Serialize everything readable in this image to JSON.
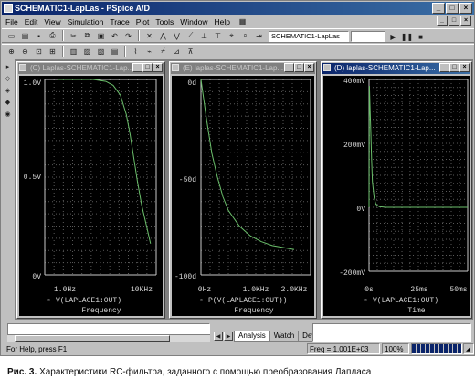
{
  "window": {
    "title": "SCHEMATIC1-LapLas - PSpice A/D",
    "min": "_",
    "max": "□",
    "close": "×"
  },
  "menu": [
    "File",
    "Edit",
    "View",
    "Simulation",
    "Trace",
    "Plot",
    "Tools",
    "Window",
    "Help"
  ],
  "toolbar": {
    "simulation_profile": "SCHEMATIC1-LapLas"
  },
  "plots": [
    {
      "title": "(C) Laplas-SCHEMATIC1-Lap...",
      "active": false,
      "y_ticks": [
        "1.0V",
        "0.5V",
        "0V"
      ],
      "x_ticks": [
        "1.0Hz",
        "10KHz"
      ],
      "trace_label": "V(LAPLACE1:OUT)",
      "x_axis_label": "Frequency"
    },
    {
      "title": "(E) laplas-SCHEMATIC1-Lap...",
      "active": false,
      "y_ticks": [
        "0d",
        "-50d",
        "-100d"
      ],
      "x_ticks": [
        "0Hz",
        "1.0KHz",
        "2.0KHz"
      ],
      "trace_label": "P(V(LAPLACE1:OUT))",
      "x_axis_label": "Frequency"
    },
    {
      "title": "(D) laplas-SCHEMATIC1-Lap...",
      "active": true,
      "y_ticks": [
        "400mV",
        "200mV",
        "0V",
        "-200mV"
      ],
      "x_ticks": [
        "0s",
        "25ms",
        "50ms"
      ],
      "trace_label": "V(LAPLACE1:OUT)",
      "x_axis_label": "Time"
    }
  ],
  "chart_data": [
    {
      "type": "line",
      "xlabel": "Frequency",
      "ylabel": "",
      "y_ticks": [
        "1.0V",
        "0.5V",
        "0V"
      ],
      "x_ticks": [
        "1.0Hz",
        "10KHz"
      ],
      "x_scale": "log",
      "x": [
        1,
        3,
        10,
        30,
        100,
        200,
        400,
        700,
        1000,
        1500,
        2000,
        3000,
        5000,
        7000
      ],
      "series": [
        {
          "name": "V(LAPLACE1:OUT)",
          "values": [
            1.0,
            1.0,
            1.0,
            1.0,
            0.99,
            0.97,
            0.92,
            0.82,
            0.72,
            0.58,
            0.48,
            0.36,
            0.24,
            0.16
          ]
        }
      ],
      "ylim": [
        0,
        1.0
      ],
      "grid": true,
      "color": "#6bbf6b"
    },
    {
      "type": "line",
      "xlabel": "Frequency",
      "ylabel": "",
      "y_ticks": [
        "0d",
        "-50d",
        "-100d"
      ],
      "x_ticks": [
        "0Hz",
        "1.0KHz",
        "2.0KHz"
      ],
      "x": [
        0,
        50,
        100,
        200,
        300,
        400,
        500,
        700,
        900,
        1100,
        1300,
        1500,
        1700
      ],
      "series": [
        {
          "name": "P(V(LAPLACE1:OUT))",
          "values": [
            0,
            -10,
            -20,
            -38,
            -50,
            -60,
            -67,
            -75,
            -80,
            -83,
            -85,
            -86,
            -87
          ]
        }
      ],
      "xlim": [
        0,
        2000
      ],
      "ylim": [
        -100,
        0
      ],
      "grid": true,
      "color": "#6bbf6b"
    },
    {
      "type": "line",
      "xlabel": "Time",
      "ylabel": "",
      "y_ticks": [
        "400mV",
        "200mV",
        "0V",
        "-200mV"
      ],
      "x_ticks": [
        "0s",
        "25ms",
        "50ms"
      ],
      "x": [
        0,
        0.2,
        0.5,
        1,
        1.5,
        2,
        3,
        4,
        6,
        10,
        20,
        30,
        40,
        50,
        58
      ],
      "series": [
        {
          "name": "V(LAPLACE1:OUT)",
          "values": [
            0,
            380,
            330,
            240,
            150,
            80,
            30,
            10,
            2,
            0,
            0,
            0,
            0,
            0,
            0
          ]
        }
      ],
      "xlim": [
        0,
        58
      ],
      "ylim": [
        -200,
        400
      ],
      "grid": true,
      "color": "#6bbf6b"
    }
  ],
  "bottom": {
    "tabs": [
      "Analysis",
      "Watch",
      "Devices"
    ]
  },
  "status": {
    "help": "For Help, press F1",
    "freq": "Freq = 1.001E+03",
    "zoom": "100%"
  },
  "caption": {
    "label": "Рис. 3.",
    "text": "Характеристики RC-фильтра, заданного с помощью преобразования Лапласа"
  }
}
